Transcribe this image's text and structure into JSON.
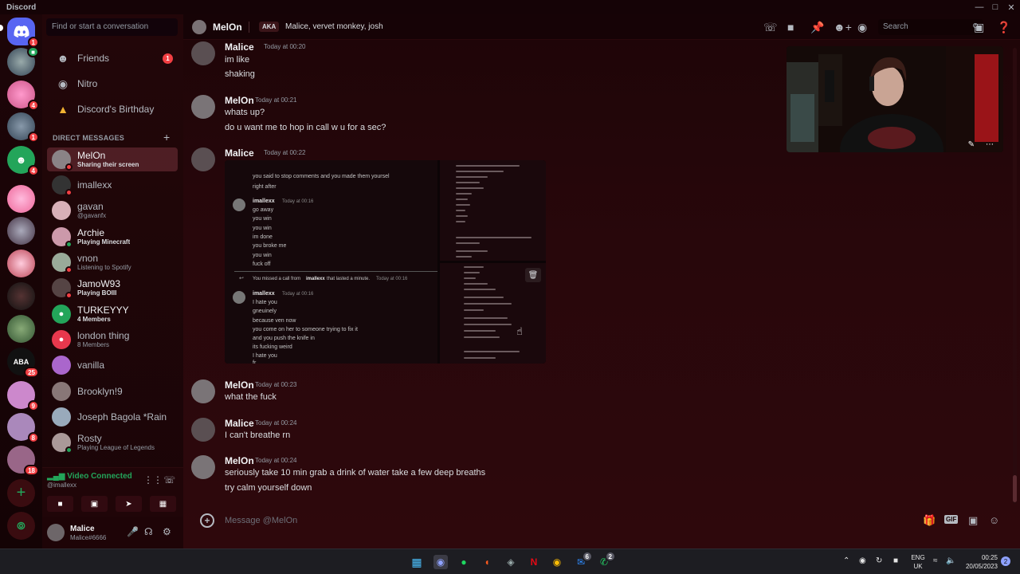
{
  "window": {
    "title": "Discord"
  },
  "colors": {
    "accent": "#5865f2",
    "online": "#23a55a",
    "dnd": "#f23f43",
    "idle": "#f0b232",
    "bg": "#2e080c"
  },
  "rail": {
    "home_badge": "1",
    "servers": [
      {
        "badge": ""
      },
      {
        "badge": "4"
      },
      {
        "badge": "1"
      },
      {
        "badge": "4"
      },
      {
        "badge": ""
      },
      {
        "badge": ""
      },
      {
        "badge": ""
      },
      {
        "badge": ""
      },
      {
        "badge": ""
      },
      {
        "badge": "25"
      },
      {
        "badge": "9"
      },
      {
        "badge": "8"
      },
      {
        "badge": "18"
      }
    ],
    "add_icon": "+",
    "explore_icon": "compass-icon"
  },
  "sidebar": {
    "search_placeholder": "Find or start a conversation",
    "nav": [
      {
        "label": "Friends",
        "badge": "1"
      },
      {
        "label": "Nitro"
      },
      {
        "label": "Discord's Birthday"
      }
    ],
    "dm_header": "DIRECT MESSAGES",
    "dms": [
      {
        "name": "MelOn",
        "sub": "Sharing their screen",
        "status": "dnd",
        "active": true
      },
      {
        "name": "imallexx",
        "sub": "",
        "status": "dnd"
      },
      {
        "name": "gavan",
        "sub": "@gavanfx",
        "status": "offline"
      },
      {
        "name": "Archie",
        "sub": "Playing Minecraft",
        "status": "online",
        "bright": true
      },
      {
        "name": "vnon",
        "sub": "Listening to Spotify",
        "status": "dnd"
      },
      {
        "name": "JamoW93",
        "sub": "Playing BOIII",
        "status": "dnd",
        "bright": true
      },
      {
        "name": "TURKEYYY",
        "sub": "4 Members",
        "status": "",
        "bright": true
      },
      {
        "name": "london thing",
        "sub": "8 Members",
        "status": ""
      },
      {
        "name": "vanilla",
        "sub": "",
        "status": "offline"
      },
      {
        "name": "Brooklyn!9",
        "sub": "",
        "status": "offline"
      },
      {
        "name": "Joseph Bagola *Rain",
        "sub": "",
        "status": "offline"
      },
      {
        "name": "Rosty",
        "sub": "Playing League of Legends",
        "status": "online"
      }
    ]
  },
  "voice": {
    "status": "Video Connected",
    "user": "@imallexx"
  },
  "user": {
    "name": "Malice",
    "tag": "Malice#6666"
  },
  "header": {
    "name": "MelOn",
    "aka_label": "AKA",
    "aka": "Malice, vervet monkey, josh",
    "search": "Search"
  },
  "messages": [
    {
      "author": "Malice",
      "time": "Today at 00:20",
      "lines": [
        "im like",
        "shaking"
      ]
    },
    {
      "author": "MelOn",
      "time": "Today at 00:21",
      "lines": [
        "whats up?",
        "do u want me to hop in call w u for a sec?"
      ]
    },
    {
      "author": "Malice",
      "time": "Today at 00:22",
      "lines": []
    },
    {
      "author": "MelOn",
      "time": "Today at 00:23",
      "lines": [
        "what the fuck"
      ]
    },
    {
      "author": "Malice",
      "time": "Today at 00:24",
      "lines": [
        "I can't breathe rn"
      ]
    },
    {
      "author": "MelOn",
      "time": "Today at 00:24",
      "lines": [
        "seriously take 10 min grab a drink of water take a few deep breaths",
        "try calm yourself down"
      ]
    }
  ],
  "attachment": {
    "top_line": "you said to stop comments and you made them yoursel",
    "top_line2": "right after",
    "author": "imallexx",
    "time": "Today at 00:16",
    "block1": [
      "go away",
      "you win",
      "you win",
      "im done",
      "you broke me",
      "you win",
      "fuck off"
    ],
    "missed_call": "You missed a call from",
    "missed_who": "imallexx",
    "missed_rest": "that lasted a minute.",
    "missed_time": "Today at 00:16",
    "block2": [
      "I hate you",
      "gneuinely",
      "because ven now",
      "you come on her to someone trying to fix it",
      "and you push the knife in",
      "its fucking weird",
      "I hate you",
      "fr"
    ]
  },
  "composer": {
    "placeholder": "Message @MelOn"
  },
  "taskbar": {
    "lang1": "ENG",
    "lang2": "UK",
    "time": "00:25",
    "date": "20/05/2023",
    "notif_badge": "2",
    "mail_badge": "6",
    "whatsapp_badge": "2"
  }
}
